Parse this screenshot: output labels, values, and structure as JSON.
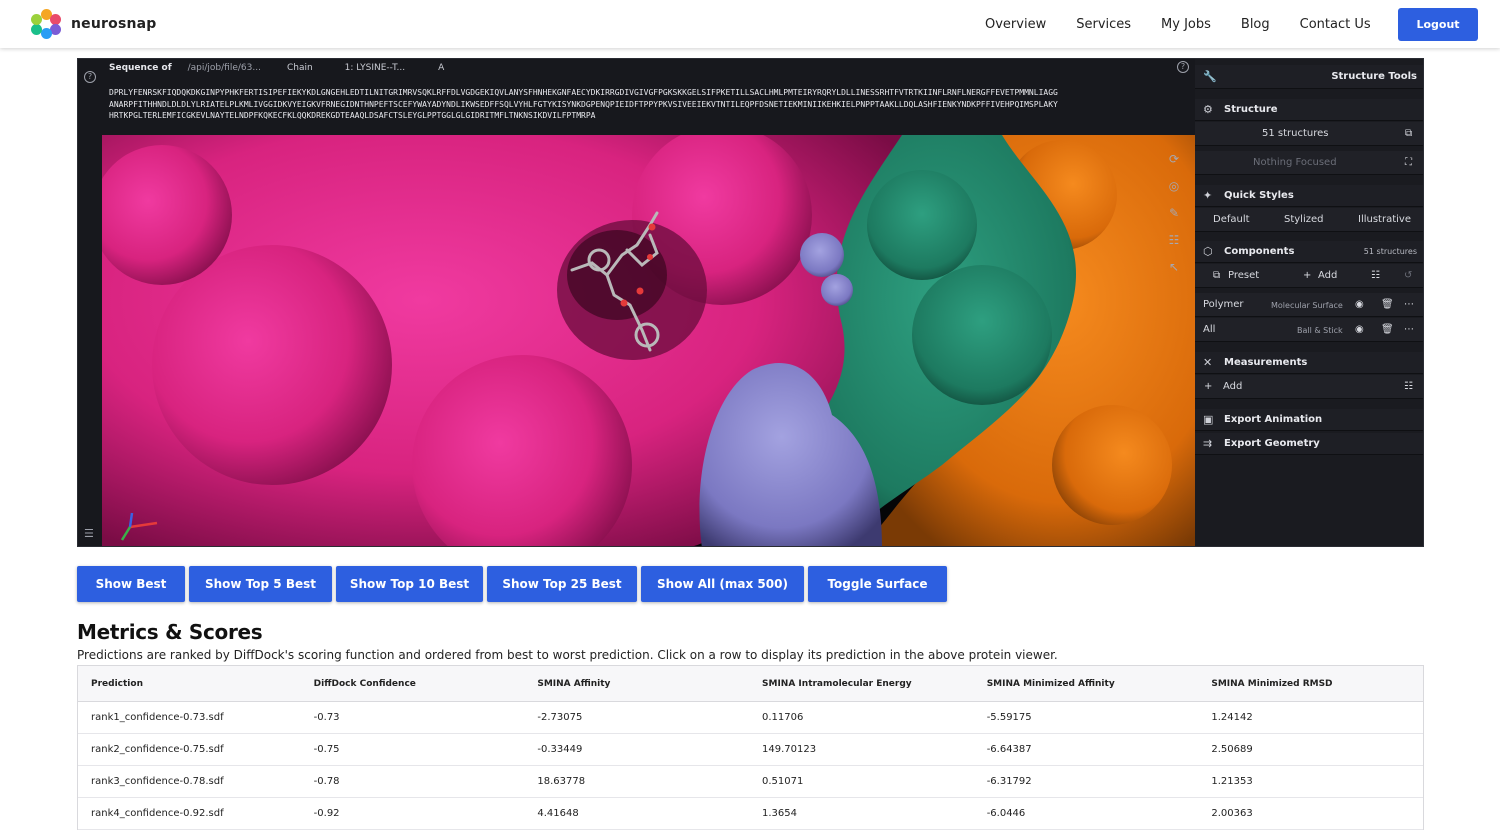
{
  "header": {
    "brand": "neurosnap",
    "nav": [
      "Overview",
      "Services",
      "My Jobs",
      "Blog",
      "Contact Us"
    ],
    "logout": "Logout"
  },
  "viewer": {
    "sequence_label": "Sequence of",
    "path": "/api/job/file/63...",
    "chain_label": "Chain",
    "chain_value": "1: LYSINE--T...",
    "chain_id": "A",
    "sequence_lines": [
      "DPRLYFENRSKFIQDQKDKGINPYPHKFERTISIPEFIEKYKDLGNGEHLEDTILNITGRIMRVSQKLRFFDLVGDGEKIQVLANYSFHNHEKGNFAECYDKIRRGDIVGIVGFPGKSKKGELSIFPKETILLSACLHMLPMTEIRYRQRYLDLLINESSRHTFVTRTKIINFLRNFLNERGFFEVETPMMNLIAGG",
      "ANARPFITHHNDLDLDLYLRIATELPLKMLIVGGIDKVYEIGKVFRNEGIDNTHNPEFTSCEFYWAYADYNDLIKWSEDFFSQLVYHLFGTYKISYNKDGPENQPIEIDFTPPYPKVSIVEEIEKVTNTILEQPFDSNETIEKMINIIKEHKIELPNPPTAAKLLDQLASHFIENKYNDKPFFIVEHPQIMSPLAKY",
      "HRTKPGLTERLEMFICGKEVLNAYTELNDPFKQKECFKLQQKDREKGDTEAAQLDSAFCTSLEYGLPPTGGLGLGIDRITMFLTNKNSIKDVILFPTMRPA"
    ]
  },
  "panel": {
    "title": "Structure Tools",
    "structure": "Structure",
    "structures_count": "51 structures",
    "nothing_focused": "Nothing Focused",
    "quick_styles": "Quick Styles",
    "styles": [
      "Default",
      "Stylized",
      "Illustrative"
    ],
    "components": "Components",
    "components_count": "51 structures",
    "preset": "Preset",
    "add": "Add",
    "polymer": "Polymer",
    "polymer_repr": "Molecular Surface",
    "all": "All",
    "all_repr": "Ball & Stick",
    "measurements": "Measurements",
    "measure_add": "Add",
    "export_animation": "Export Animation",
    "export_geometry": "Export Geometry"
  },
  "buttons": [
    "Show Best",
    "Show Top 5 Best",
    "Show Top 10 Best",
    "Show Top 25 Best",
    "Show All (max 500)",
    "Toggle Surface"
  ],
  "metrics": {
    "title": "Metrics & Scores",
    "subtitle": "Predictions are ranked by DiffDock's scoring function and ordered from best to worst prediction. Click on a row to display its prediction in the above protein viewer.",
    "columns": [
      "Prediction",
      "DiffDock Confidence",
      "SMINA Affinity",
      "SMINA Intramolecular Energy",
      "SMINA Minimized Affinity",
      "SMINA Minimized RMSD"
    ],
    "rows": [
      [
        "rank1_confidence-0.73.sdf",
        "-0.73",
        "-2.73075",
        "0.11706",
        "-5.59175",
        "1.24142"
      ],
      [
        "rank2_confidence-0.75.sdf",
        "-0.75",
        "-0.33449",
        "149.70123",
        "-6.64387",
        "2.50689"
      ],
      [
        "rank3_confidence-0.78.sdf",
        "-0.78",
        "18.63778",
        "0.51071",
        "-6.31792",
        "1.21353"
      ],
      [
        "rank4_confidence-0.92.sdf",
        "-0.92",
        "4.41648",
        "1.3654",
        "-6.0446",
        "2.00363"
      ]
    ]
  }
}
